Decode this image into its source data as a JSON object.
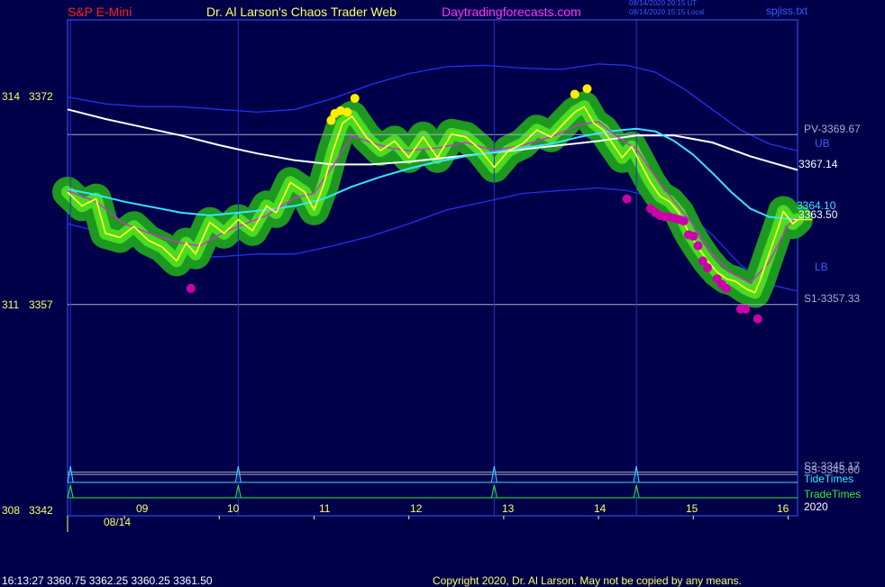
{
  "header": {
    "instrument": "S&P E-Mini",
    "site": "Dr. Al Larson's Chaos Trader Web",
    "url": "Daytradingforecasts.com",
    "time_utc": "08/14/2020 20:15 UT",
    "time_local": "08/14/2020 15:15 Local",
    "filename": "spjiss.txt"
  },
  "footer": {
    "quote": "16:13:27  3360.75 3362.25 3360.25 3361.50",
    "copyright": "Copyright 2020, Dr. Al Larson. May not be copied by any means."
  },
  "colors": {
    "background": "#00004a",
    "frame": "#3a5cff",
    "price": "#ffff33",
    "short_ma": "#cc33cc",
    "mid_ma": "#33e6ff",
    "long_ma": "#ffffff",
    "bands": "#2233ee",
    "cloud": "#1fa01f",
    "high_dots": "#ffee00",
    "low_dots": "#cc00aa",
    "pivot": "#aaaacc"
  },
  "chart_data": {
    "type": "line",
    "title": "S&P E-Mini",
    "x_date_label": "08/14",
    "year_label": "2020",
    "x_ticks": [
      "09",
      "10",
      "11",
      "12",
      "13",
      "14",
      "15",
      "16"
    ],
    "y_ticks": [
      {
        "left": "314",
        "price": "3372",
        "value": 3372
      },
      {
        "left": "311",
        "price": "3357",
        "value": 3357
      },
      {
        "left": "308",
        "price": "3342",
        "value": 3342
      }
    ],
    "ylim": [
      3342,
      3378
    ],
    "xlim": [
      8.4,
      16.1
    ],
    "levels": [
      {
        "label": "PV-3369.67",
        "value": 3369.67,
        "color": "#aaaacc"
      },
      {
        "label": "S1-3357.33",
        "value": 3357.33,
        "color": "#aaaacc"
      },
      {
        "label": "S2-3345.17",
        "value": 3345.17,
        "color": "#aaaacc"
      },
      {
        "label": "S3-3345.00",
        "value": 3345.0,
        "color": "#aaaacc"
      }
    ],
    "band_labels": {
      "upper": "UB",
      "lower": "LB"
    },
    "end_values": [
      {
        "label": "3367.14",
        "value": 3367.14,
        "color": "#ffffff"
      },
      {
        "label": "3364.10",
        "value": 3364.1,
        "color": "#33e6ff"
      },
      {
        "label": "3363.50",
        "value": 3363.5,
        "color": "#ffff33"
      }
    ],
    "tide_label": "TideTimes",
    "trade_label": "TradeTimes",
    "event_times": [
      8.43,
      10.2,
      12.9,
      14.4
    ],
    "series": [
      {
        "name": "price",
        "x": [
          8.4,
          8.55,
          8.7,
          8.8,
          8.95,
          9.1,
          9.25,
          9.4,
          9.55,
          9.65,
          9.75,
          9.9,
          10.05,
          10.2,
          10.35,
          10.5,
          10.6,
          10.75,
          10.9,
          11.0,
          11.1,
          11.2,
          11.3,
          11.4,
          11.55,
          11.7,
          11.85,
          12.0,
          12.15,
          12.3,
          12.45,
          12.6,
          12.75,
          12.9,
          13.05,
          13.2,
          13.35,
          13.5,
          13.65,
          13.75,
          13.85,
          13.95,
          14.05,
          14.15,
          14.25,
          14.35,
          14.45,
          14.55,
          14.65,
          14.75,
          14.85,
          14.95,
          15.05,
          15.15,
          15.25,
          15.35,
          15.45,
          15.55,
          15.65,
          15.7,
          15.8,
          15.9,
          15.95,
          16.05,
          16.1
        ],
        "y": [
          3365.5,
          3364.5,
          3365.0,
          3362.5,
          3362.2,
          3363.0,
          3362.0,
          3361.5,
          3360.5,
          3361.8,
          3361.0,
          3363.3,
          3362.5,
          3363.5,
          3362.7,
          3364.5,
          3364.0,
          3366.2,
          3365.5,
          3364.2,
          3366.0,
          3368.5,
          3370.5,
          3371.0,
          3369.5,
          3368.5,
          3369.2,
          3368.0,
          3369.5,
          3368.0,
          3369.7,
          3369.5,
          3368.6,
          3367.3,
          3368.5,
          3369.0,
          3370.0,
          3369.5,
          3370.6,
          3371.3,
          3371.7,
          3370.5,
          3370.0,
          3369.0,
          3368.0,
          3368.8,
          3367.5,
          3366.2,
          3365.2,
          3364.8,
          3364.0,
          3362.6,
          3361.5,
          3360.5,
          3359.7,
          3359.2,
          3359.0,
          3358.5,
          3358.2,
          3359.0,
          3361.0,
          3363.0,
          3364.1,
          3363.2,
          3363.5
        ]
      },
      {
        "name": "short_ma",
        "x": [
          8.4,
          8.7,
          9.0,
          9.3,
          9.6,
          9.8,
          10.0,
          10.2,
          10.5,
          10.8,
          11.0,
          11.2,
          11.4,
          11.6,
          11.8,
          12.0,
          12.3,
          12.6,
          12.9,
          13.2,
          13.5,
          13.8,
          14.0,
          14.2,
          14.4,
          14.6,
          14.8,
          15.0,
          15.2,
          15.4,
          15.6,
          15.8,
          16.0,
          16.1
        ],
        "y": [
          3365.6,
          3364.8,
          3363.2,
          3362.4,
          3361.8,
          3361.6,
          3362.4,
          3363.0,
          3363.8,
          3365.1,
          3365.4,
          3367.4,
          3369.6,
          3369.1,
          3368.7,
          3368.5,
          3368.7,
          3369.1,
          3368.5,
          3368.9,
          3369.5,
          3370.4,
          3370.6,
          3369.5,
          3368.6,
          3366.6,
          3364.8,
          3363.1,
          3361.0,
          3359.6,
          3358.9,
          3360.4,
          3363.1,
          3363.6
        ]
      },
      {
        "name": "mid_ma",
        "x": [
          8.4,
          8.7,
          9.0,
          9.3,
          9.6,
          9.9,
          10.2,
          10.5,
          10.8,
          11.1,
          11.4,
          11.7,
          12.0,
          12.3,
          12.6,
          12.9,
          13.2,
          13.5,
          13.8,
          14.1,
          14.4,
          14.6,
          14.8,
          15.0,
          15.2,
          15.4,
          15.6,
          15.8,
          16.1
        ],
        "y": [
          3365.7,
          3365.3,
          3364.8,
          3364.4,
          3364.0,
          3363.8,
          3364.0,
          3364.2,
          3364.5,
          3365.0,
          3365.9,
          3366.6,
          3367.2,
          3367.7,
          3368.1,
          3368.4,
          3368.7,
          3369.0,
          3369.5,
          3369.9,
          3370.1,
          3369.9,
          3369.2,
          3368.2,
          3366.9,
          3365.5,
          3364.3,
          3363.7,
          3363.5
        ]
      },
      {
        "name": "long_ma",
        "x": [
          8.4,
          8.8,
          9.2,
          9.6,
          10.0,
          10.4,
          10.8,
          11.2,
          11.6,
          12.0,
          12.4,
          12.8,
          13.2,
          13.6,
          14.0,
          14.4,
          14.8,
          15.2,
          15.6,
          15.9,
          16.1
        ],
        "y": [
          3371.5,
          3370.8,
          3370.2,
          3369.6,
          3368.9,
          3368.3,
          3367.8,
          3367.5,
          3367.5,
          3367.7,
          3368.0,
          3368.3,
          3368.6,
          3368.9,
          3369.2,
          3369.6,
          3369.6,
          3369.1,
          3368.1,
          3367.5,
          3367.1
        ]
      },
      {
        "name": "upper_band",
        "x": [
          8.4,
          8.8,
          9.2,
          9.6,
          10.0,
          10.4,
          10.8,
          11.2,
          11.6,
          12.0,
          12.4,
          12.8,
          13.2,
          13.6,
          14.0,
          14.3,
          14.6,
          14.9,
          15.2,
          15.5,
          15.8,
          16.1
        ],
        "y": [
          3372.4,
          3371.9,
          3371.7,
          3371.7,
          3371.5,
          3371.3,
          3371.5,
          3372.3,
          3373.3,
          3374.1,
          3374.6,
          3374.7,
          3374.5,
          3374.4,
          3374.8,
          3374.7,
          3374.2,
          3373.0,
          3371.5,
          3370.0,
          3369.0,
          3368.5
        ]
      },
      {
        "name": "lower_band",
        "x": [
          8.4,
          8.8,
          9.2,
          9.6,
          10.0,
          10.4,
          10.8,
          11.2,
          11.6,
          12.0,
          12.4,
          12.8,
          13.2,
          13.6,
          14.0,
          14.3,
          14.6,
          14.9,
          15.2,
          15.5,
          15.8,
          16.1
        ],
        "y": [
          3363.2,
          3362.5,
          3361.7,
          3360.8,
          3360.8,
          3361.0,
          3361.0,
          3361.6,
          3362.3,
          3363.2,
          3364.2,
          3364.8,
          3365.4,
          3365.6,
          3365.8,
          3365.6,
          3365.1,
          3364.1,
          3362.4,
          3360.2,
          3358.8,
          3358.3
        ]
      }
    ],
    "high_dots": [
      {
        "x": 11.18,
        "y": 3370.7
      },
      {
        "x": 11.22,
        "y": 3371.2
      },
      {
        "x": 11.28,
        "y": 3371.4
      },
      {
        "x": 11.35,
        "y": 3371.3
      },
      {
        "x": 11.43,
        "y": 3372.3
      },
      {
        "x": 13.75,
        "y": 3372.6
      },
      {
        "x": 13.88,
        "y": 3373.0
      }
    ],
    "low_dots": [
      {
        "x": 9.7,
        "y": 3358.5
      },
      {
        "x": 14.3,
        "y": 3365.0
      },
      {
        "x": 14.55,
        "y": 3364.3
      },
      {
        "x": 14.6,
        "y": 3364.0
      },
      {
        "x": 14.65,
        "y": 3363.8
      },
      {
        "x": 14.7,
        "y": 3363.7
      },
      {
        "x": 14.75,
        "y": 3363.7
      },
      {
        "x": 14.8,
        "y": 3363.6
      },
      {
        "x": 14.85,
        "y": 3363.5
      },
      {
        "x": 14.9,
        "y": 3363.4
      },
      {
        "x": 14.95,
        "y": 3362.4
      },
      {
        "x": 15.0,
        "y": 3362.3
      },
      {
        "x": 15.05,
        "y": 3361.6
      },
      {
        "x": 15.1,
        "y": 3360.5
      },
      {
        "x": 15.15,
        "y": 3360.0
      },
      {
        "x": 15.25,
        "y": 3359.2
      },
      {
        "x": 15.3,
        "y": 3358.8
      },
      {
        "x": 15.35,
        "y": 3358.5
      },
      {
        "x": 15.5,
        "y": 3357.0
      },
      {
        "x": 15.55,
        "y": 3357.0
      },
      {
        "x": 15.68,
        "y": 3356.3
      }
    ]
  }
}
